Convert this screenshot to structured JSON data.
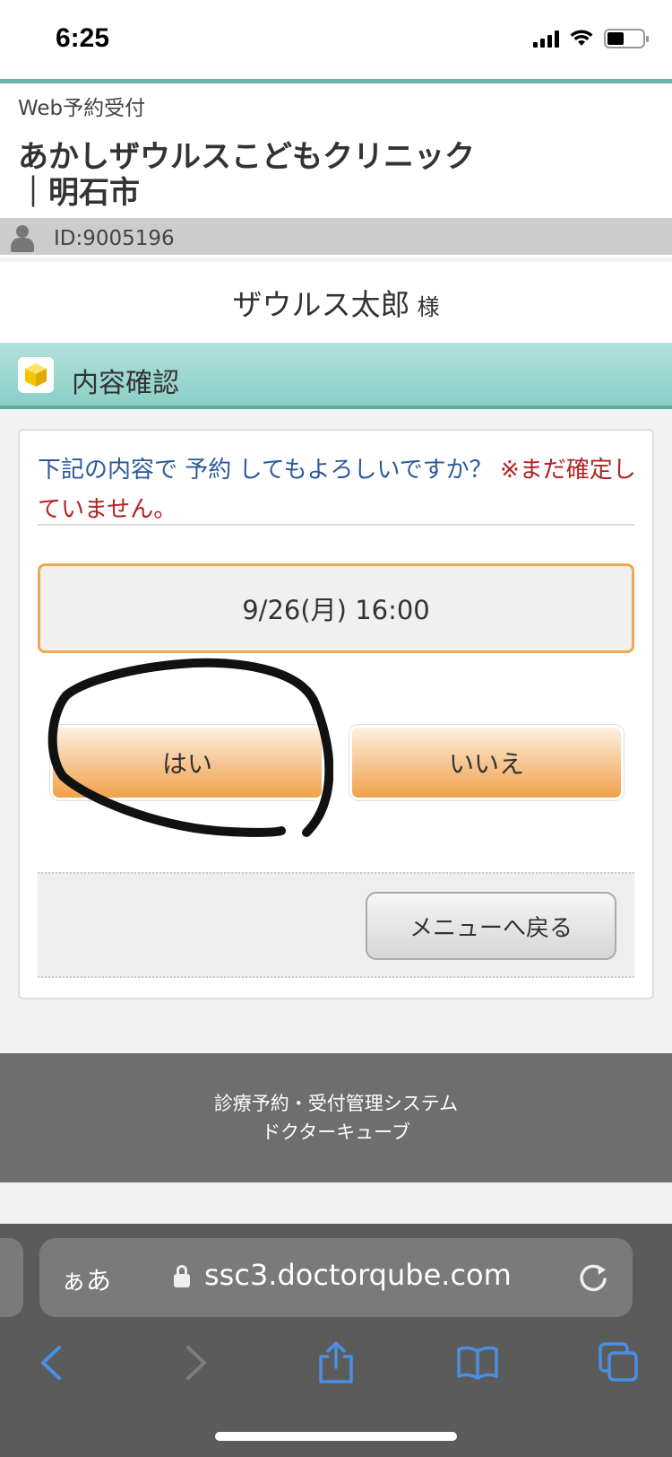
{
  "status_bar": {
    "time": "6:25"
  },
  "header": {
    "subtitle": "Web予約受付",
    "clinic_name": "あかしザウルスこどもクリニック　｜明石市"
  },
  "account": {
    "id": "ID:9005196"
  },
  "patient": {
    "name": "ザウルス太郎",
    "honorific": "様"
  },
  "section": {
    "title": "内容確認"
  },
  "confirm": {
    "question": "下記の内容で 予約 してもよろしいですか？",
    "warning": "※まだ確定していません。",
    "datetime": "9/26(月) 16:00",
    "yes_label": "はい",
    "no_label": "いいえ",
    "menu_label": "メニューへ戻る"
  },
  "footer": {
    "line1": "診療予約・受付管理システム",
    "line2": "ドクターキューブ"
  },
  "browser": {
    "aa_label": "ぁあ",
    "url": "ssc3.doctorqube.com"
  },
  "colors": {
    "accent_teal": "#69b3a8",
    "button_orange": "#f1a24b",
    "question_blue": "#2b5a9a",
    "warning_red": "#b22222",
    "browser_icon_blue": "#4a90e2"
  }
}
